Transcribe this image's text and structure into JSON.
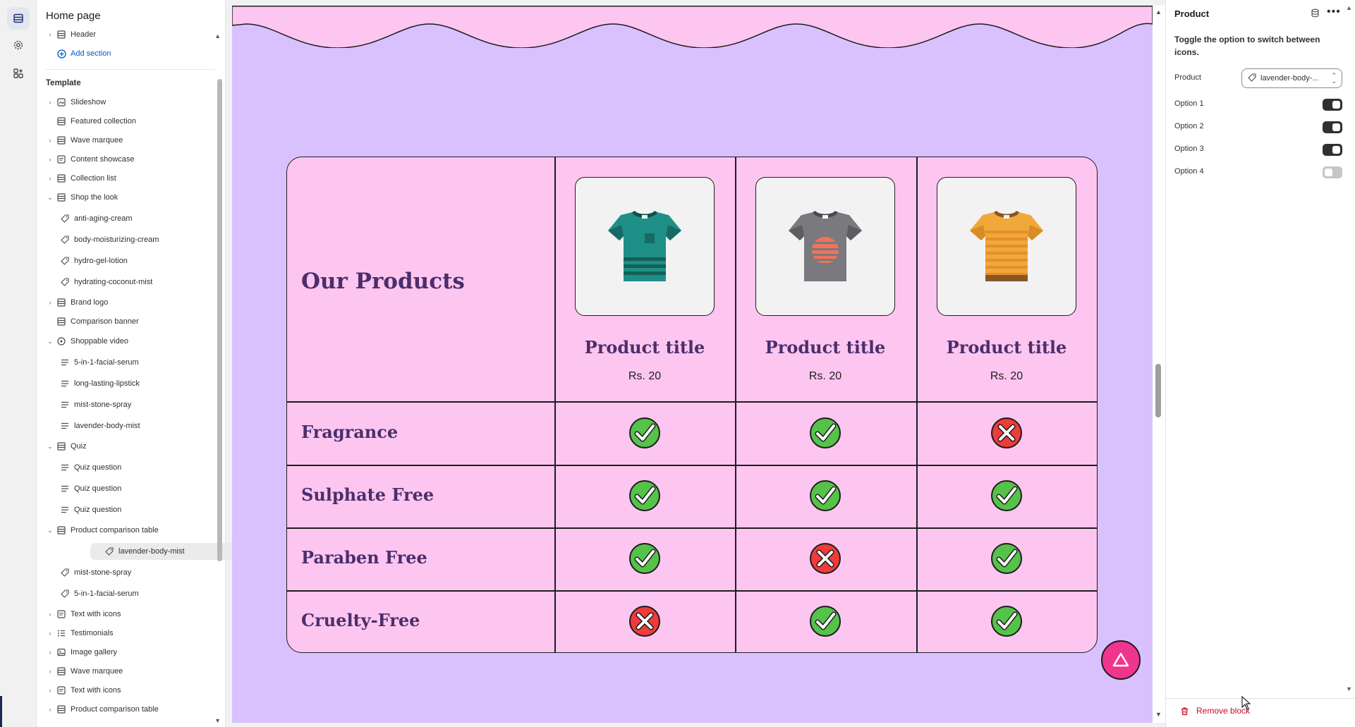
{
  "sidebar": {
    "title": "Home page",
    "header_item": "Header",
    "add_section": "Add section",
    "template_label": "Template",
    "items": [
      {
        "label": "Slideshow",
        "type": "section",
        "chev": "›",
        "icon": "slideshow-icon"
      },
      {
        "label": "Featured collection",
        "type": "section",
        "chev": "",
        "icon": "section-icon"
      },
      {
        "label": "Wave marquee",
        "type": "section",
        "chev": "›",
        "icon": "section-icon"
      },
      {
        "label": "Content showcase",
        "type": "section",
        "chev": "›",
        "icon": "text-block-icon"
      },
      {
        "label": "Collection list",
        "type": "section",
        "chev": "›",
        "icon": "section-icon"
      },
      {
        "label": "Shop the look",
        "type": "section",
        "chev": "⌄",
        "icon": "section-icon"
      },
      {
        "label": "anti-aging-cream",
        "type": "child",
        "icon": "tag-icon"
      },
      {
        "label": "body-moisturizing-cream",
        "type": "child",
        "icon": "tag-icon"
      },
      {
        "label": "hydro-gel-lotion",
        "type": "child",
        "icon": "tag-icon"
      },
      {
        "label": "hydrating-coconut-mist",
        "type": "child",
        "icon": "tag-icon"
      },
      {
        "label": "Brand logo",
        "type": "section",
        "chev": "›",
        "icon": "section-icon"
      },
      {
        "label": "Comparison banner",
        "type": "section",
        "chev": "",
        "icon": "section-icon"
      },
      {
        "label": "Shoppable video",
        "type": "section",
        "chev": "⌄",
        "icon": "play-icon"
      },
      {
        "label": "5-in-1-facial-serum",
        "type": "child",
        "icon": "lines-icon"
      },
      {
        "label": "long-lasting-lipstick",
        "type": "child",
        "icon": "lines-icon"
      },
      {
        "label": "mist-stone-spray",
        "type": "child",
        "icon": "lines-icon"
      },
      {
        "label": "lavender-body-mist",
        "type": "child",
        "icon": "lines-icon"
      },
      {
        "label": "Quiz",
        "type": "section",
        "chev": "⌄",
        "icon": "section-icon"
      },
      {
        "label": "Quiz question",
        "type": "child",
        "icon": "lines-icon"
      },
      {
        "label": "Quiz question",
        "type": "child",
        "icon": "lines-icon"
      },
      {
        "label": "Quiz question",
        "type": "child",
        "icon": "lines-icon"
      },
      {
        "label": "Product comparison table",
        "type": "section",
        "chev": "⌄",
        "icon": "section-icon"
      },
      {
        "label": "lavender-body-mist",
        "type": "child",
        "icon": "tag-icon",
        "selected": true
      },
      {
        "label": "mist-stone-spray",
        "type": "child",
        "icon": "tag-icon"
      },
      {
        "label": "5-in-1-facial-serum",
        "type": "child",
        "icon": "tag-icon"
      },
      {
        "label": "Text with icons",
        "type": "section",
        "chev": "›",
        "icon": "text-block-icon"
      },
      {
        "label": "Testimonials",
        "type": "section",
        "chev": "›",
        "icon": "list-icon"
      },
      {
        "label": "Image gallery",
        "type": "section",
        "chev": "›",
        "icon": "image-icon"
      },
      {
        "label": "Wave marquee",
        "type": "section",
        "chev": "›",
        "icon": "section-icon"
      },
      {
        "label": "Text with icons",
        "type": "section",
        "chev": "›",
        "icon": "text-block-icon"
      },
      {
        "label": "Product comparison table",
        "type": "section",
        "chev": "›",
        "icon": "section-icon"
      }
    ]
  },
  "preview": {
    "heading": "Our Products",
    "products": [
      {
        "title": "Product title",
        "price": "Rs. 20",
        "shirt": "teal"
      },
      {
        "title": "Product title",
        "price": "Rs. 20",
        "shirt": "gray"
      },
      {
        "title": "Product title",
        "price": "Rs. 20",
        "shirt": "orange"
      }
    ],
    "features": [
      {
        "label": "Fragrance",
        "values": [
          true,
          true,
          false
        ]
      },
      {
        "label": "Sulphate Free",
        "values": [
          true,
          true,
          true
        ]
      },
      {
        "label": "Paraben Free",
        "values": [
          true,
          false,
          true
        ]
      },
      {
        "label": "Cruelty-Free",
        "values": [
          false,
          true,
          true
        ]
      }
    ],
    "colors": {
      "background": "#d9c1ff",
      "table": "#fdc6f0",
      "heading": "#4b2e6b",
      "check": "#55c24a",
      "cross": "#ef3b3b",
      "fab": "#f0358e"
    }
  },
  "panel": {
    "title": "Product",
    "help_text": "Toggle the option to switch between icons.",
    "product_label": "Product",
    "product_value": "lavender-body-...",
    "options": [
      {
        "label": "Option 1",
        "on": true
      },
      {
        "label": "Option 2",
        "on": true
      },
      {
        "label": "Option 3",
        "on": true
      },
      {
        "label": "Option 4",
        "on": false
      }
    ],
    "remove_label": "Remove block"
  }
}
